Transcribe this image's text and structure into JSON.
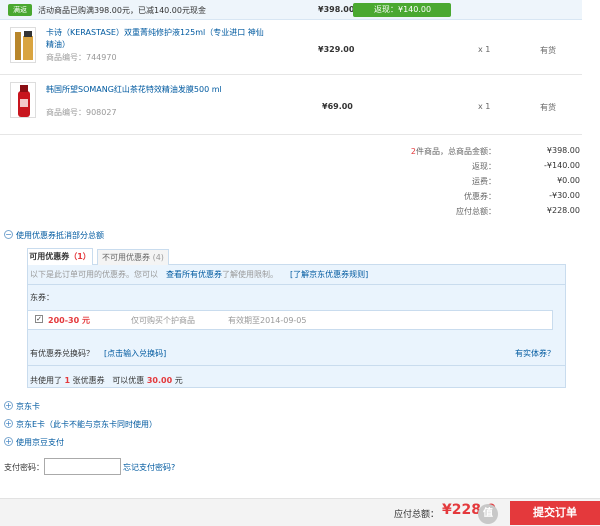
{
  "promo": {
    "tag": "满返",
    "text": "活动商品已购满398.00元，已减140.00元现金",
    "price": "¥398.00",
    "return_label": "返现：¥140.00"
  },
  "products": [
    {
      "name": "卡诗（KERASTASE）双重菁纯修护液125ml（专业进口 神仙精油）",
      "code": "商品编号：744970",
      "price": "¥329.00",
      "qty": "x 1",
      "stock": "有货"
    },
    {
      "name": "韩国所望SOMANG红山茶花特效精油发膜500 ml",
      "code": "商品编号：908027",
      "price": "¥69.00",
      "qty": "x 1",
      "stock": "有货"
    }
  ],
  "summary": {
    "count_num": "2",
    "rows": [
      {
        "label": "件商品，总商品金额：",
        "value": "¥398.00"
      },
      {
        "label": "返现：",
        "value": "-¥140.00"
      },
      {
        "label": "运费：",
        "value": "¥0.00"
      },
      {
        "label": "优惠券：",
        "value": "-¥30.00"
      },
      {
        "label": "应付总额：",
        "value": "¥228.00"
      }
    ]
  },
  "coupon": {
    "toggle_label": "使用优惠券抵消部分总额",
    "tab_available": "可用优惠券",
    "tab_available_count": "（1）",
    "tab_unavailable": "不可用优惠券",
    "tab_unavailable_count": "(4)",
    "hint": "以下是此订单可用的优惠券。您可以",
    "link_view_all": "查看所有优惠券",
    "hint_2": "了解使用限制。",
    "link_rules": "[了解京东优惠券规则]",
    "dongquan_label": "东券：",
    "item_value": "200-30 元",
    "item_desc": "仅可购买个护商品",
    "item_expiry": "有效期至2014-09-05",
    "exchange_q": "有优惠券兑换码？",
    "exchange_link": "[点击输入兑换码]",
    "entity_link": "有实体券？",
    "used_prefix": "共使用了",
    "used_count": "1",
    "used_mid": "张优惠券",
    "discount_prefix": "可以优惠",
    "discount_value": "30.00",
    "discount_suffix": "元"
  },
  "options": [
    {
      "label": "京东卡"
    },
    {
      "label": "京东E卡（此卡不能与京东卡同时使用）"
    },
    {
      "label": "使用京豆支付"
    }
  ],
  "pay": {
    "pwd_label": "支付密码：",
    "forgot": "忘记支付密码?"
  },
  "footer": {
    "total_label": "应付总额：",
    "total_value": "¥228.0",
    "submit_label": "提交订单",
    "logo_text": "值"
  }
}
